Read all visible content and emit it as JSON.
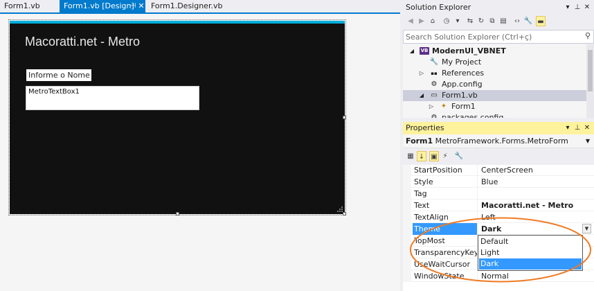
{
  "document_tabs": [
    {
      "label": "Form1.vb",
      "active": false
    },
    {
      "label": "Form1.vb [Design]",
      "active": true
    },
    {
      "label": "Form1.Designer.vb",
      "active": false
    }
  ],
  "tab_controls": {
    "pin": "⊣",
    "close": "✕"
  },
  "designer": {
    "form_title": "Macoratti.net - Metro",
    "label_text": "Informe o Nome :",
    "textbox_text": "MetroTextBox1"
  },
  "solution_explorer": {
    "title": "Solution Explorer",
    "search_placeholder": "Search Solution Explorer (Ctrl+ç)",
    "tree": [
      {
        "label": "ModernUI_VBNET",
        "bold": true,
        "expander": "◢",
        "icon": "VB"
      },
      {
        "label": "My Project",
        "bold": false,
        "expander": "",
        "icon": "🔧"
      },
      {
        "label": "References",
        "bold": false,
        "expander": "▷",
        "icon": "▪▪"
      },
      {
        "label": "App.config",
        "bold": false,
        "expander": "",
        "icon": "⚙"
      },
      {
        "label": "Form1.vb",
        "bold": false,
        "expander": "◢",
        "icon": "▭",
        "selected": true
      },
      {
        "label": "Form1",
        "bold": false,
        "expander": "▷",
        "icon": "✦"
      },
      {
        "label": "packages.config",
        "bold": false,
        "expander": "",
        "icon": "⚙"
      }
    ]
  },
  "properties": {
    "title": "Properties",
    "object_name": "Form1",
    "object_type": "MetroFramework.Forms.MetroForm",
    "rows": [
      {
        "name": "StartPosition",
        "value": "CenterScreen"
      },
      {
        "name": "Style",
        "value": "Blue"
      },
      {
        "name": "Tag",
        "value": ""
      },
      {
        "name": "Text",
        "value": "Macoratti.net - Metro"
      },
      {
        "name": "TextAlign",
        "value": "Left"
      },
      {
        "name": "Theme",
        "value": "Dark"
      },
      {
        "name": "TopMost",
        "value": ""
      },
      {
        "name": "TransparencyKey",
        "value": ""
      },
      {
        "name": "UseWaitCursor",
        "value": ""
      },
      {
        "name": "WindowState",
        "value": "Normal"
      }
    ],
    "theme_options": [
      "Default",
      "Light",
      "Dark"
    ],
    "theme_selected": "Dark"
  },
  "colors": {
    "accent": "#007acc",
    "form_background": "#111111",
    "metro_blue": "#00aeda",
    "selection": "#3399ff",
    "active_header": "#fff29d",
    "annotation": "#f07a22"
  }
}
